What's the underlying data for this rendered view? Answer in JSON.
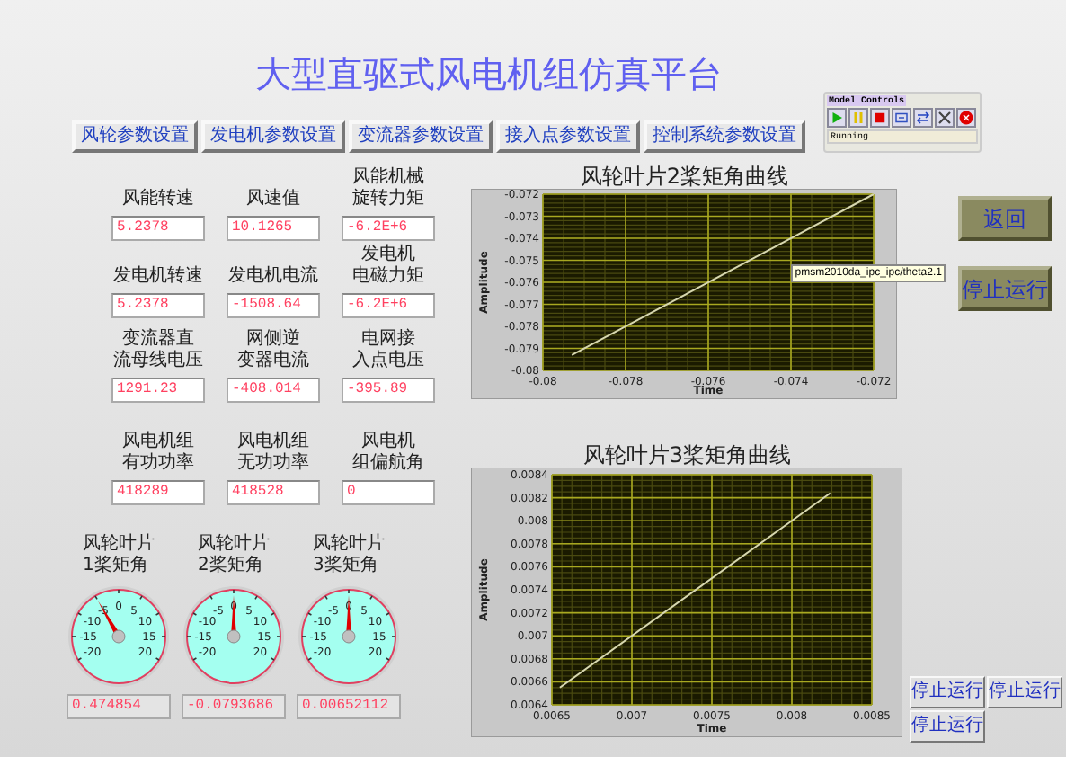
{
  "title": "大型直驱式风电机组仿真平台",
  "nav_buttons": [
    "风轮参数设置",
    "发电机参数设置",
    "变流器参数设置",
    "接入点参数设置",
    "控制系统参数设置"
  ],
  "model_controls": {
    "title": "Model Controls",
    "status": "Running"
  },
  "indicators": [
    [
      {
        "label": [
          "风能转速"
        ],
        "value": "5.2378"
      },
      {
        "label": [
          "风速值"
        ],
        "value": "10.1265"
      },
      {
        "label": [
          "风能机械",
          "旋转力矩"
        ],
        "value": "-6.2E+6"
      }
    ],
    [
      {
        "label": [
          "发电机转速"
        ],
        "value": "5.2378"
      },
      {
        "label": [
          "发电机电流"
        ],
        "value": "-1508.64"
      },
      {
        "label": [
          "发电机",
          "电磁力矩"
        ],
        "value": "-6.2E+6"
      }
    ],
    [
      {
        "label": [
          "变流器直",
          "流母线电压"
        ],
        "value": "1291.23"
      },
      {
        "label": [
          "网侧逆",
          "变器电流"
        ],
        "value": "-408.014"
      },
      {
        "label": [
          "电网接",
          "入点电压"
        ],
        "value": "-395.89"
      }
    ],
    [
      {
        "label": [
          "风电机组",
          "有功功率"
        ],
        "value": "418289"
      },
      {
        "label": [
          "风电机组",
          "无功功率"
        ],
        "value": "418528"
      },
      {
        "label": [
          "风电机",
          "组偏航角"
        ],
        "value": "0"
      }
    ]
  ],
  "gauges": [
    {
      "label": [
        "风轮叶片",
        "1桨矩角"
      ],
      "level": 0.4,
      "reading": "0.474854",
      "scale": [
        "0",
        "-5",
        "5",
        "-10",
        "10",
        "-15",
        "15",
        "-20",
        "20"
      ]
    },
    {
      "label": [
        "风轮叶片",
        "2桨矩角"
      ],
      "level": 0.5,
      "reading": "-0.0793686",
      "scale": [
        "0",
        "-5",
        "5",
        "-10",
        "10",
        "-15",
        "15",
        "-20",
        "20"
      ]
    },
    {
      "label": [
        "风轮叶片",
        "3桨矩角"
      ],
      "level": 0.5,
      "reading": "0.00652112",
      "scale": [
        "0",
        "-5",
        "5",
        "-10",
        "10",
        "-15",
        "15",
        "-20",
        "20"
      ]
    }
  ],
  "charts": [
    {
      "title": "风轮叶片2桨矩角曲线",
      "tooltip": "pmsm2010da_ipc_ipc/theta2.1",
      "chart_data": {
        "type": "line",
        "xlabel": "Time",
        "ylabel": "Amplitude",
        "grid": true,
        "x": [
          -0.0793,
          -0.072
        ],
        "series": [
          {
            "color": "#d8d8b0",
            "values": [
              -0.0793,
              -0.072
            ]
          }
        ],
        "xlim": [
          -0.08,
          -0.072
        ],
        "ylim": [
          -0.08,
          -0.072
        ],
        "xticks": [
          -0.08,
          -0.078,
          -0.076,
          -0.074,
          -0.072
        ],
        "yticks": [
          -0.072,
          -0.073,
          -0.074,
          -0.075,
          -0.076,
          -0.077,
          -0.078,
          -0.079,
          -0.08
        ]
      }
    },
    {
      "title": "风轮叶片3桨矩角曲线",
      "chart_data": {
        "type": "line",
        "xlabel": "Time",
        "ylabel": "Amplitude",
        "grid": true,
        "x": [
          0.00655,
          0.00824
        ],
        "series": [
          {
            "color": "#d8d8b0",
            "values": [
              0.00655,
              0.00824
            ]
          }
        ],
        "xlim": [
          0.0065,
          0.0085
        ],
        "ylim": [
          0.0064,
          0.0084
        ],
        "xticks": [
          0.0065,
          0.007,
          0.0075,
          0.008,
          0.0085
        ],
        "yticks": [
          0.0084,
          0.0082,
          0.008,
          0.0078,
          0.0076,
          0.0074,
          0.0072,
          0.007,
          0.0068,
          0.0066,
          0.0064
        ]
      }
    }
  ],
  "side_buttons": [
    "返回",
    "停止运行"
  ],
  "small_buttons": [
    "停止运行",
    "停止运行",
    "停止运行"
  ]
}
